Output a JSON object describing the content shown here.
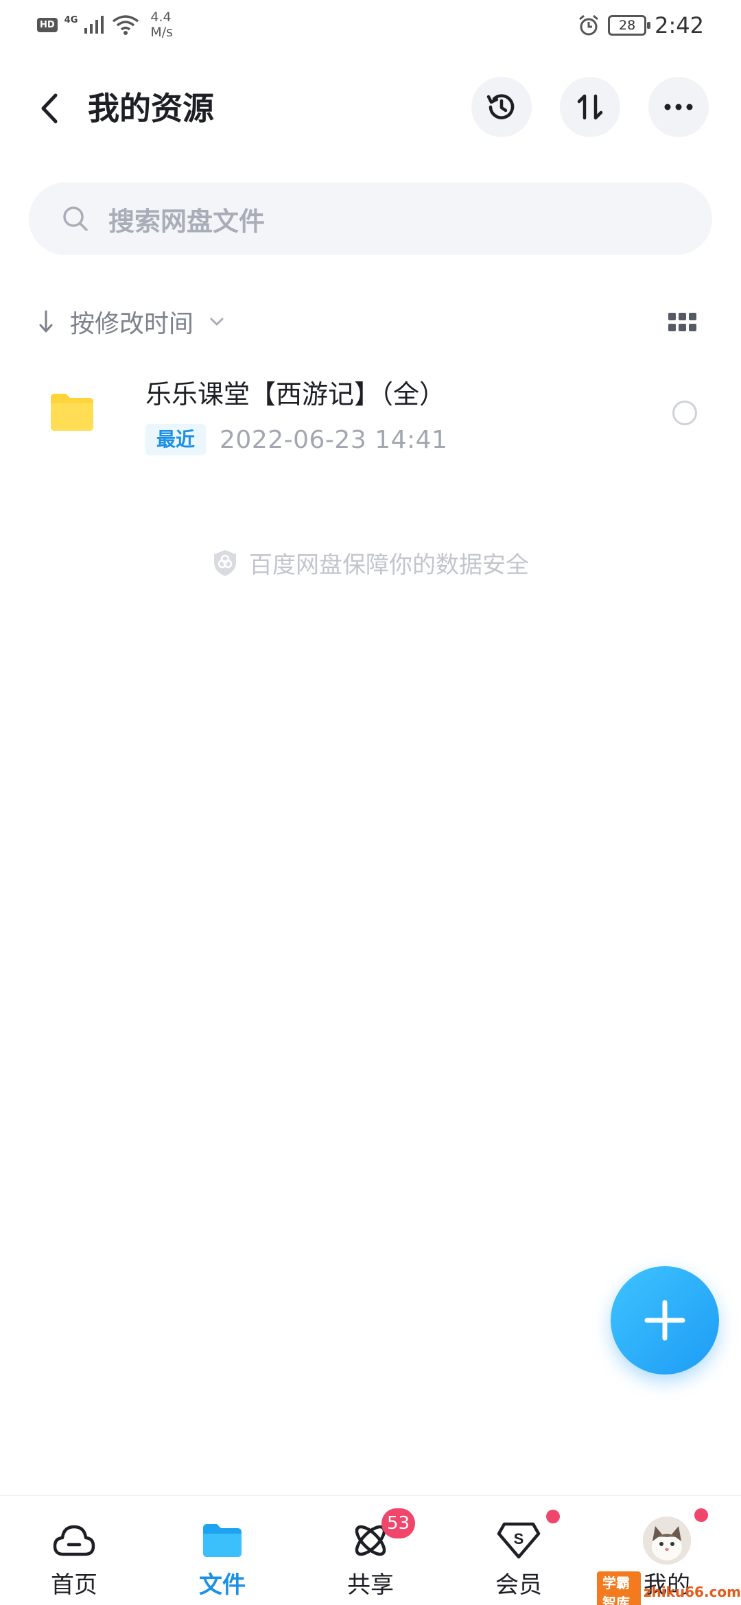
{
  "status_bar": {
    "hd": "HD",
    "network": "4G",
    "speed_value": "4.4",
    "speed_unit": "M/s",
    "battery": "28",
    "time": "2:42"
  },
  "header": {
    "title": "我的资源",
    "icons": [
      "back-icon",
      "history-icon",
      "sort-icon",
      "more-icon"
    ]
  },
  "search": {
    "placeholder": "搜索网盘文件"
  },
  "sort": {
    "label": "按修改时间"
  },
  "files": [
    {
      "name": "乐乐课堂【西游记】（全）",
      "badge": "最近",
      "date": "2022-06-23  14:41"
    }
  ],
  "footer_note": "百度网盘保障你的数据安全",
  "nav": {
    "items": [
      {
        "label": "首页",
        "icon": "cloud-icon"
      },
      {
        "label": "文件",
        "icon": "folder-icon"
      },
      {
        "label": "共享",
        "icon": "share-icon",
        "badge": "53"
      },
      {
        "label": "会员",
        "icon": "vip-icon"
      },
      {
        "label": "我的",
        "icon": "avatar"
      }
    ]
  },
  "watermark": {
    "badge": "学霸智库",
    "site": "zhiku66.com"
  },
  "colors": {
    "accent": "#1a90e6",
    "folder": "#ffd43b",
    "badge_red": "#f0466b",
    "fab": "#1d9cf5"
  }
}
